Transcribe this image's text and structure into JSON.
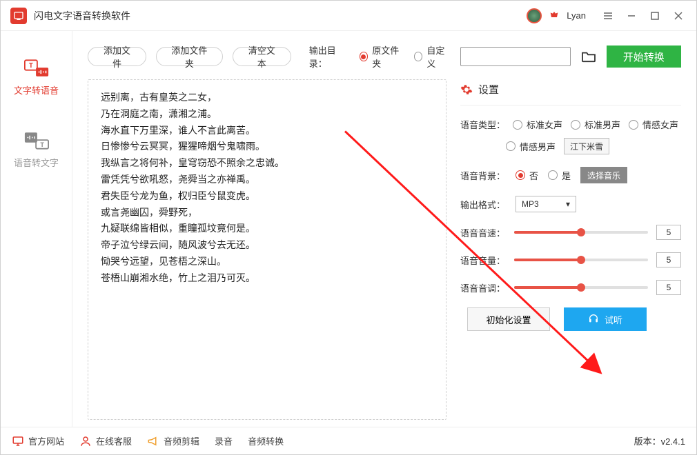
{
  "app": {
    "title": "闪电文字语音转换软件"
  },
  "user": {
    "name": "Lyan"
  },
  "sidebar": {
    "tts_label": "文字转语音",
    "stt_label": "语音转文字"
  },
  "toolbar": {
    "add_file": "添加文件",
    "add_folder": "添加文件夹",
    "clear_text": "清空文本",
    "output_dir_label": "输出目录：",
    "radio_source": "原文件夹",
    "radio_custom": "自定义",
    "start": "开始转换"
  },
  "text_content": "远别离，古有皇英之二女，\n乃在洞庭之南，潇湘之浦。\n海水直下万里深，谁人不言此离苦。\n日惨惨兮云冥冥，猩猩啼烟兮鬼啸雨。\n我纵言之将何补，皇穹窃恐不照余之忠诚。\n雷凭凭兮欲吼怒，尧舜当之亦禅禹。\n君失臣兮龙为鱼，权归臣兮鼠变虎。\n或言尧幽囚，舜野死，\n九疑联绵皆相似，重瞳孤坟竟何是。\n帝子泣兮绿云间，随风波兮去无还。\n恸哭兮远望，见苍梧之深山。\n苍梧山崩湘水绝，竹上之泪乃可灭。",
  "settings": {
    "header": "设置",
    "voice_type_label": "语音类型：",
    "voice_types": {
      "std_female": "标准女声",
      "std_male": "标准男声",
      "emo_female": "情感女声",
      "emo_male": "情感男声"
    },
    "voice_name": "江下米雪",
    "bg_label": "语音背景：",
    "bg_no": "否",
    "bg_yes": "是",
    "select_music": "选择音乐",
    "fmt_label": "输出格式：",
    "fmt_value": "MP3",
    "speed_label": "语音音速：",
    "speed_value": "5",
    "volume_label": "语音音量：",
    "volume_value": "5",
    "pitch_label": "语音音调：",
    "pitch_value": "5",
    "reset": "初始化设置",
    "preview": "试听"
  },
  "footer": {
    "site": "官方网站",
    "support": "在线客服",
    "audio_edit": "音频剪辑",
    "record": "录音",
    "audio_convert": "音频转换",
    "version_label": "版本：",
    "version": "v2.4.1"
  }
}
